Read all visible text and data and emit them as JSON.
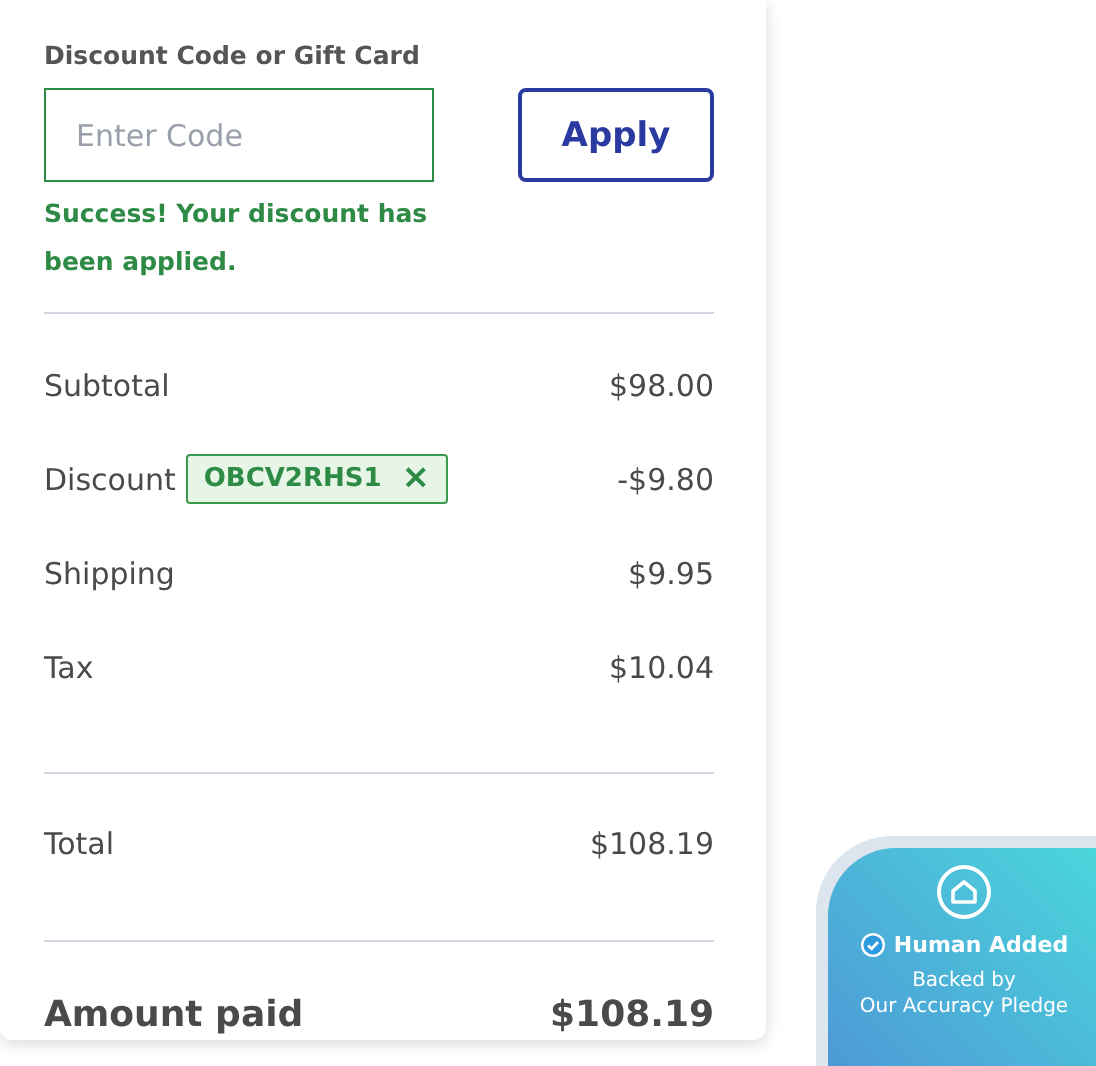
{
  "discount_form": {
    "label": "Discount Code or Gift Card",
    "placeholder": "Enter Code",
    "button": "Apply",
    "message": "Success! Your discount has been applied."
  },
  "line_items": [
    {
      "label": "Subtotal",
      "amount": "$98.00"
    },
    {
      "label": "Discount",
      "code": "OBCV2RHS1",
      "remove": "×",
      "amount": "-$9.80"
    },
    {
      "label": "Shipping",
      "amount": "$9.95"
    },
    {
      "label": "Tax",
      "amount": "$10.04"
    }
  ],
  "total": {
    "label": "Total",
    "amount": "$108.19"
  },
  "amount_paid": {
    "label": "Amount paid",
    "amount": "$108.19"
  },
  "badge": {
    "title": "Human Added",
    "subtitle_lines": [
      "Backed by",
      "Our Accuracy Pledge"
    ]
  }
}
